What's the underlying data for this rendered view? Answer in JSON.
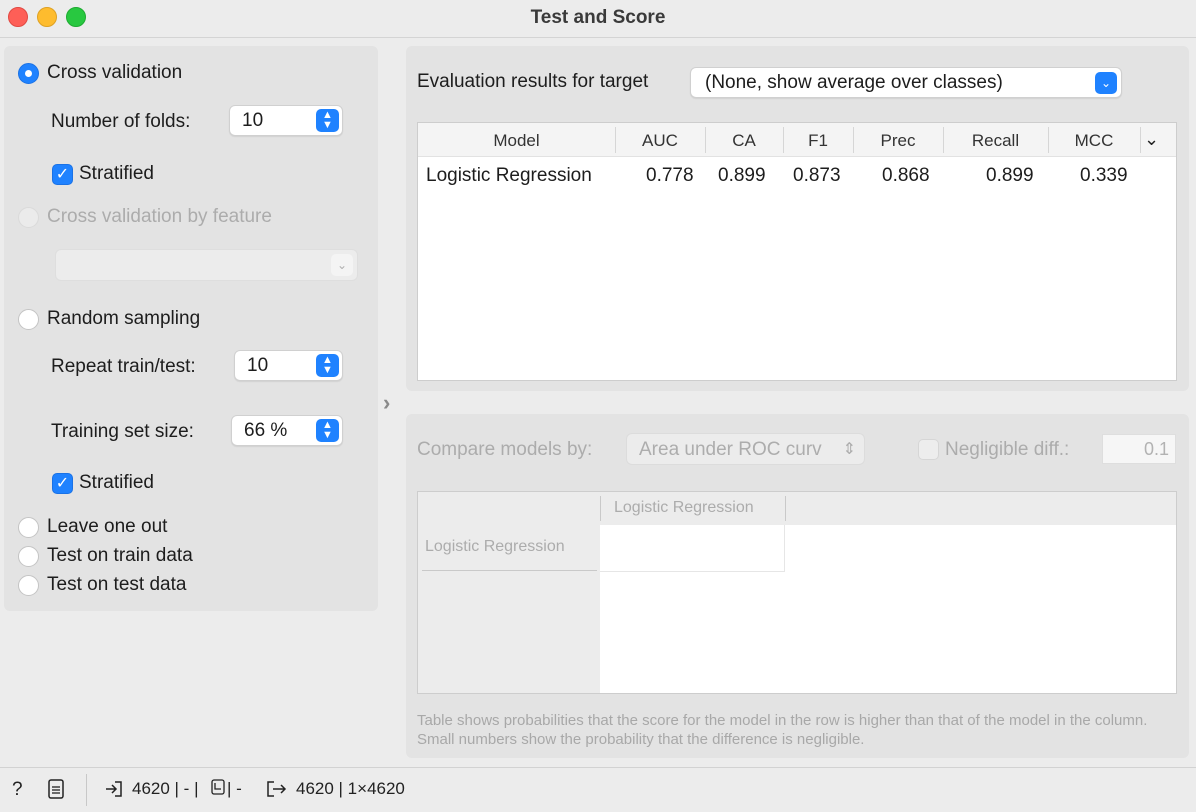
{
  "window": {
    "title": "Test and Score"
  },
  "sampling": {
    "cross_validation": {
      "label": "Cross validation",
      "folds_label": "Number of folds:",
      "folds_value": "10",
      "stratified_label": "Stratified"
    },
    "cv_by_feature": {
      "label": "Cross validation by feature",
      "selected": ""
    },
    "random_sampling": {
      "label": "Random sampling",
      "repeat_label": "Repeat train/test:",
      "repeat_value": "10",
      "train_size_label": "Training set size:",
      "train_size_value": "66 %",
      "stratified_label": "Stratified"
    },
    "leave_one_out": {
      "label": "Leave one out"
    },
    "test_train": {
      "label": "Test on train data"
    },
    "test_test": {
      "label": "Test on test data"
    }
  },
  "evaluation": {
    "target_label": "Evaluation results for target",
    "target_value": "(None, show average over classes)",
    "columns": [
      "Model",
      "AUC",
      "CA",
      "F1",
      "Prec",
      "Recall",
      "MCC"
    ],
    "rows": [
      {
        "model": "Logistic Regression",
        "auc": "0.778",
        "ca": "0.899",
        "f1": "0.873",
        "prec": "0.868",
        "recall": "0.899",
        "mcc": "0.339"
      }
    ]
  },
  "comparison": {
    "compare_label": "Compare models by:",
    "compare_value": "Area under ROC curv",
    "negligible_label": "Negligible diff.:",
    "negligible_value": "0.1",
    "col_header": "Logistic Regression",
    "row_header": "Logistic Regression",
    "note": "Table shows probabilities that the score for the model in the row is higher than that of the model in the column. Small numbers show the probability that the difference is negligible."
  },
  "status": {
    "input_summary": "4620 | - | ",
    "input_summary_tail": " | -",
    "output_summary": "4620 | 1×4620"
  },
  "icons": [
    "help-icon",
    "report-icon",
    "input-icon",
    "data-icon",
    "output-icon",
    "chevron-down-icon",
    "splitter-arrow-icon"
  ],
  "colors": {
    "accent": "#1f82ff",
    "panel": "#e3e3e3",
    "window": "#ececec"
  }
}
